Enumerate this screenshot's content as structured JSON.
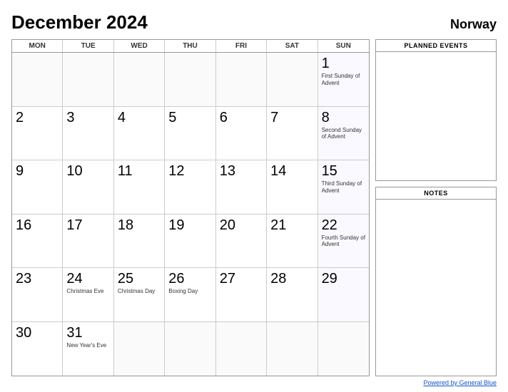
{
  "header": {
    "title": "December 2024",
    "country": "Norway"
  },
  "day_headers": [
    "MON",
    "TUE",
    "WED",
    "THU",
    "FRI",
    "SAT",
    "SUN"
  ],
  "weeks": [
    [
      {
        "num": "",
        "event": "",
        "empty": true
      },
      {
        "num": "",
        "event": "",
        "empty": true
      },
      {
        "num": "",
        "event": "",
        "empty": true
      },
      {
        "num": "",
        "event": "",
        "empty": true
      },
      {
        "num": "",
        "event": "",
        "empty": true
      },
      {
        "num": "",
        "event": "",
        "empty": true
      },
      {
        "num": "1",
        "event": "First Sunday of Advent",
        "sunday": true
      }
    ],
    [
      {
        "num": "2",
        "event": ""
      },
      {
        "num": "3",
        "event": ""
      },
      {
        "num": "4",
        "event": ""
      },
      {
        "num": "5",
        "event": ""
      },
      {
        "num": "6",
        "event": ""
      },
      {
        "num": "7",
        "event": ""
      },
      {
        "num": "8",
        "event": "Second Sunday of Advent",
        "sunday": true
      }
    ],
    [
      {
        "num": "9",
        "event": ""
      },
      {
        "num": "10",
        "event": ""
      },
      {
        "num": "11",
        "event": ""
      },
      {
        "num": "12",
        "event": ""
      },
      {
        "num": "13",
        "event": ""
      },
      {
        "num": "14",
        "event": ""
      },
      {
        "num": "15",
        "event": "Third Sunday of Advent",
        "sunday": true
      }
    ],
    [
      {
        "num": "16",
        "event": ""
      },
      {
        "num": "17",
        "event": ""
      },
      {
        "num": "18",
        "event": ""
      },
      {
        "num": "19",
        "event": ""
      },
      {
        "num": "20",
        "event": ""
      },
      {
        "num": "21",
        "event": ""
      },
      {
        "num": "22",
        "event": "Fourth Sunday of Advent",
        "sunday": true
      }
    ],
    [
      {
        "num": "23",
        "event": ""
      },
      {
        "num": "24",
        "event": "Christmas Eve"
      },
      {
        "num": "25",
        "event": "Christmas Day"
      },
      {
        "num": "26",
        "event": "Boxing Day"
      },
      {
        "num": "27",
        "event": ""
      },
      {
        "num": "28",
        "event": ""
      },
      {
        "num": "29",
        "event": "",
        "sunday": true
      }
    ],
    [
      {
        "num": "30",
        "event": "",
        "last": true
      },
      {
        "num": "31",
        "event": "New Year's Eve",
        "last": true
      },
      {
        "num": "",
        "event": "",
        "empty": true,
        "last": true
      },
      {
        "num": "",
        "event": "",
        "empty": true,
        "last": true
      },
      {
        "num": "",
        "event": "",
        "empty": true,
        "last": true
      },
      {
        "num": "",
        "event": "",
        "empty": true,
        "last": true
      },
      {
        "num": "",
        "event": "",
        "empty": true,
        "last": true,
        "sunday": true
      }
    ]
  ],
  "sidebar": {
    "planned_events_title": "PLANNED EVENTS",
    "notes_title": "NOTES"
  },
  "footer": {
    "link_text": "Powered by General Blue"
  }
}
